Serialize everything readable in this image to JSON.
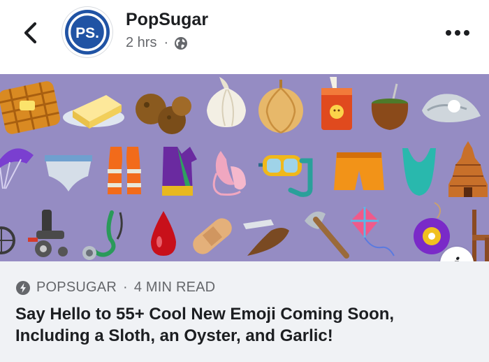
{
  "header": {
    "page_name": "PopSugar",
    "avatar_text": "PS.",
    "timestamp": "2 hrs",
    "separator": "·",
    "back_icon": "chevron-left-icon",
    "privacy_icon": "globe-icon",
    "menu_icon": "more-horizontal-icon"
  },
  "media": {
    "background_color": "#958cc3",
    "info_icon": "info-icon",
    "info_label": "i",
    "emoji_rows": [
      [
        "waffle",
        "butter",
        "falafel",
        "garlic",
        "onion",
        "juice-box",
        "mate",
        "oyster"
      ],
      [
        "parachute",
        "briefs",
        "safety-vest",
        "sari",
        "ballet-shoes",
        "diving-mask",
        "shorts",
        "swimsuit",
        "hindu-temple"
      ],
      [
        "manual-wheelchair",
        "motorized-wheelchair",
        "stethoscope",
        "drop-of-blood",
        "adhesive-bandage",
        "razor",
        "axe",
        "kite",
        "yo-yo",
        "chair"
      ]
    ]
  },
  "link_preview": {
    "source_icon": "lightning-bolt-icon",
    "source": "POPSUGAR",
    "separator": "·",
    "read_time": "4 MIN READ",
    "title": "Say Hello to 55+ Cool New Emoji Coming Soon, Including a Sloth, an Oyster, and Garlic!"
  },
  "colors": {
    "brand_blue": "#2053a4",
    "text_primary": "#1c1e21",
    "text_secondary": "#65676b",
    "preview_bg": "#f0f2f5"
  }
}
